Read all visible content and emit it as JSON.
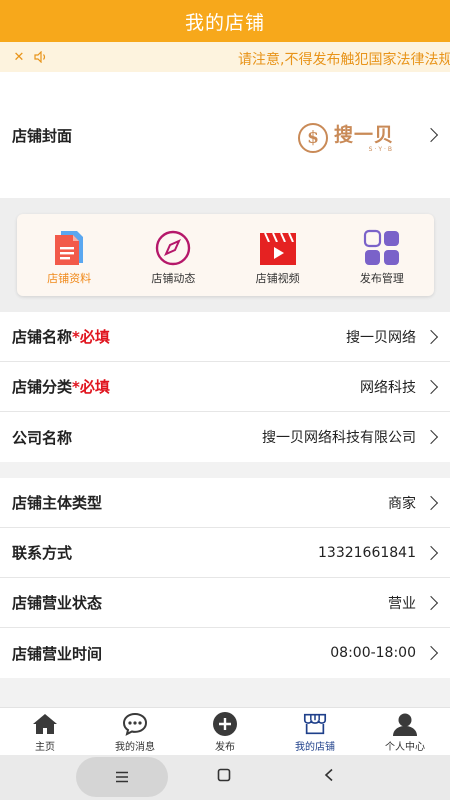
{
  "header": {
    "title": "我的店铺"
  },
  "notice": {
    "text": "请注意,不得发布触犯国家法律法规的信息",
    "close_icon": "close-icon",
    "speaker_icon": "speaker-icon"
  },
  "cover": {
    "label": "店铺封面",
    "logo_text": "搜一贝",
    "logo_sub": "S·Y·B",
    "logo_symbol": "$"
  },
  "shortcuts": [
    {
      "label": "店铺资料",
      "icon": "document-icon",
      "active": true
    },
    {
      "label": "店铺动态",
      "icon": "compass-icon",
      "active": false
    },
    {
      "label": "店铺视频",
      "icon": "video-icon",
      "active": false
    },
    {
      "label": "发布管理",
      "icon": "grid-icon",
      "active": false
    }
  ],
  "info_group1": {
    "rows": [
      {
        "label": "店铺名称",
        "required": "*必填",
        "value": "搜一贝网络"
      },
      {
        "label": "店铺分类",
        "required": "*必填",
        "value": "网络科技"
      },
      {
        "label": "公司名称",
        "required": "",
        "value": "搜一贝网络科技有限公司"
      }
    ]
  },
  "info_group2": {
    "rows": [
      {
        "label": "店铺主体类型",
        "value": "商家"
      },
      {
        "label": "联系方式",
        "value": "13321661841"
      },
      {
        "label": "店铺营业状态",
        "value": "营业"
      },
      {
        "label": "店铺营业时间",
        "value": "08:00-18:00"
      }
    ]
  },
  "tabbar": {
    "tabs": [
      {
        "label": "主页",
        "icon": "home-icon"
      },
      {
        "label": "我的消息",
        "icon": "chat-icon"
      },
      {
        "label": "发布",
        "icon": "plus-circle-icon"
      },
      {
        "label": "我的店铺",
        "icon": "shop-icon",
        "active": true
      },
      {
        "label": "个人中心",
        "icon": "person-icon"
      }
    ]
  },
  "colors": {
    "brand": "#f7a81b",
    "accent": "#f08a1c",
    "required": "#e0141e",
    "tab_active": "#1e3f8a"
  }
}
